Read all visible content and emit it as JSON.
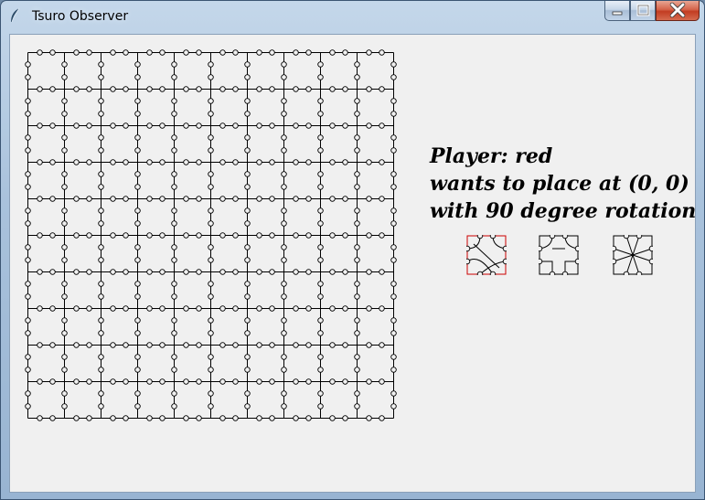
{
  "window": {
    "title": "Tsuro Observer",
    "controls": [
      "minimize",
      "maximize",
      "close"
    ]
  },
  "board": {
    "rows": 10,
    "cols": 10
  },
  "info": {
    "line1": "Player: red",
    "line2": "wants to place at (0, 0)",
    "line3": "with 90 degree rotation"
  },
  "hand": {
    "tiles": [
      {
        "icon": "tile-curved-paths-icon",
        "selected": true
      },
      {
        "icon": "tile-bridge-paths-icon",
        "selected": false
      },
      {
        "icon": "tile-star-paths-icon",
        "selected": false
      }
    ],
    "selected_color": "#cc0000"
  }
}
